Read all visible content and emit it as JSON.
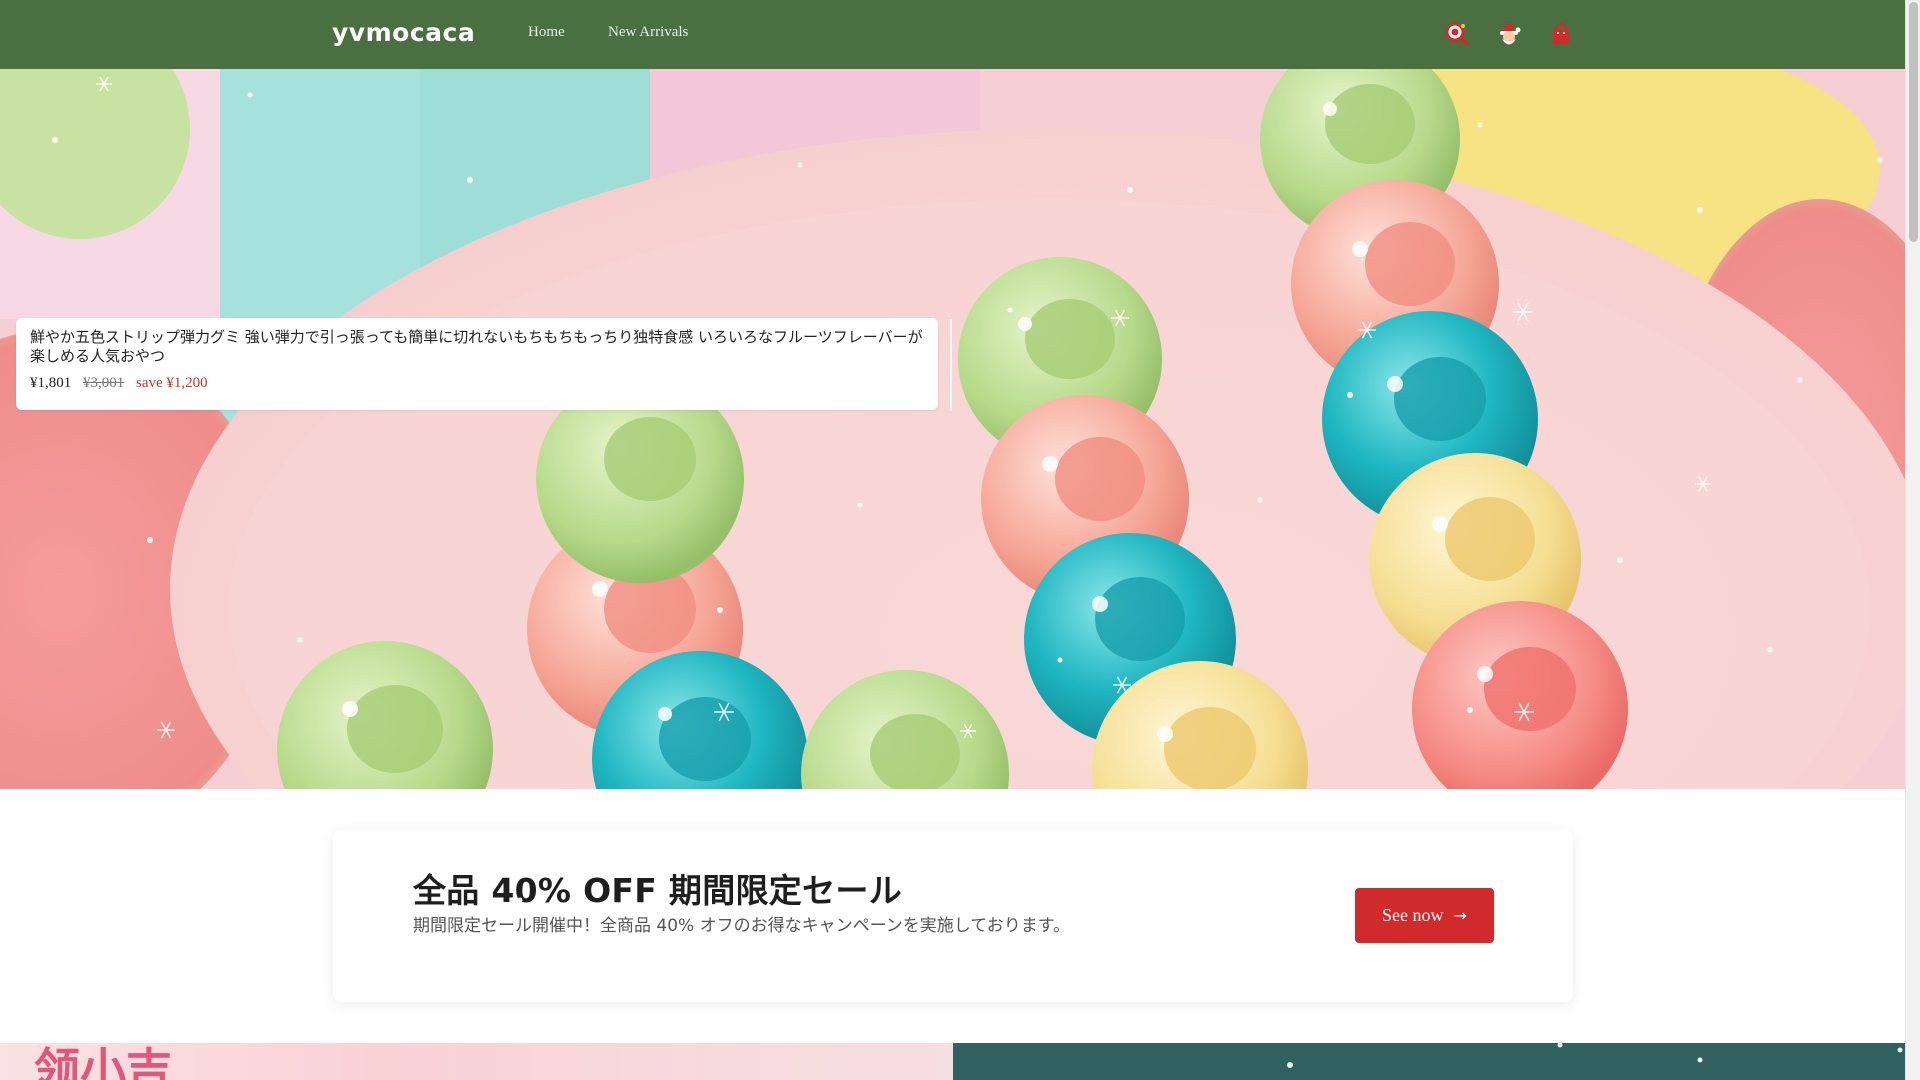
{
  "header": {
    "logo": "yvmocaca",
    "nav": [
      "Home",
      "New Arrivals"
    ],
    "icons": [
      "search-icon",
      "santa-account-icon",
      "shopping-bag-icon"
    ],
    "background": "#4a7042"
  },
  "hero": {
    "product": {
      "title": "鮮やか五色ストリップ弾力グミ 強い弾力で引っ張っても簡単に切れないもちもちもっちり独特食感 いろいろなフルーツフレーバーが楽しめる人気おやつ",
      "price": "¥1,801",
      "compare_price": "¥3,001",
      "save": "save ¥1,200"
    }
  },
  "promo": {
    "title": "全品 40% OFF 期間限定セール",
    "subtitle": "期間限定セール開催中！全商品 40% オフのお得なキャンペーンを実施しております。",
    "button": "See now",
    "button_color": "#d12a2a"
  },
  "bottom": {
    "left_logo": "领小吉"
  },
  "colors": {
    "accent": "#d12a2a",
    "header": "#4a7042",
    "teal_panel": "#2e6160"
  }
}
